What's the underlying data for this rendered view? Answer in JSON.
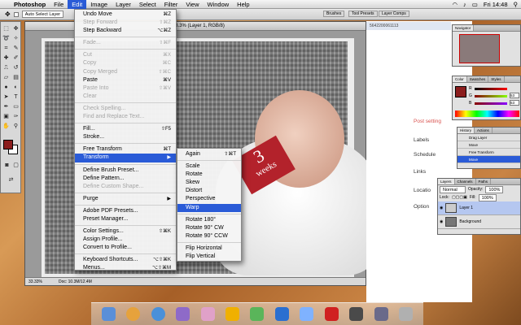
{
  "menubar": {
    "app_name": "Photoshop",
    "items": [
      "File",
      "Edit",
      "Image",
      "Layer",
      "Select",
      "Filter",
      "View",
      "Window",
      "Help"
    ],
    "active_item": "Edit",
    "clock": "Fri 14:48"
  },
  "options_bar": {
    "auto_select_label": "Auto Select Layer"
  },
  "document": {
    "title": "@ 33.3% (Layer 1, RGB/8)",
    "zoom": "33.33%",
    "doc_size": "Doc: 10.3M/12.4M",
    "photo_text_number": "3",
    "photo_text_word": "weeks"
  },
  "edit_menu": [
    {
      "label": "Undo Move",
      "shortcut": "⌘Z",
      "disabled": false
    },
    {
      "label": "Step Forward",
      "shortcut": "⇧⌘Z",
      "disabled": true
    },
    {
      "label": "Step Backward",
      "shortcut": "⌥⌘Z",
      "disabled": false
    },
    {
      "sep": true
    },
    {
      "label": "Fade...",
      "shortcut": "⇧⌘F",
      "disabled": true
    },
    {
      "sep": true
    },
    {
      "label": "Cut",
      "shortcut": "⌘X",
      "disabled": true
    },
    {
      "label": "Copy",
      "shortcut": "⌘C",
      "disabled": true
    },
    {
      "label": "Copy Merged",
      "shortcut": "⇧⌘C",
      "disabled": true
    },
    {
      "label": "Paste",
      "shortcut": "⌘V",
      "disabled": false
    },
    {
      "label": "Paste Into",
      "shortcut": "⇧⌘V",
      "disabled": true
    },
    {
      "label": "Clear",
      "shortcut": "",
      "disabled": true
    },
    {
      "sep": true
    },
    {
      "label": "Check Spelling...",
      "shortcut": "",
      "disabled": true
    },
    {
      "label": "Find and Replace Text...",
      "shortcut": "",
      "disabled": true
    },
    {
      "sep": true
    },
    {
      "label": "Fill...",
      "shortcut": "⇧F5",
      "disabled": false
    },
    {
      "label": "Stroke...",
      "shortcut": "",
      "disabled": false
    },
    {
      "sep": true
    },
    {
      "label": "Free Transform",
      "shortcut": "⌘T",
      "disabled": false
    },
    {
      "label": "Transform",
      "shortcut": "▶",
      "disabled": false,
      "highlight": true
    },
    {
      "sep": true
    },
    {
      "label": "Define Brush Preset...",
      "shortcut": "",
      "disabled": false
    },
    {
      "label": "Define Pattern...",
      "shortcut": "",
      "disabled": false
    },
    {
      "label": "Define Custom Shape...",
      "shortcut": "",
      "disabled": true
    },
    {
      "sep": true
    },
    {
      "label": "Purge",
      "shortcut": "▶",
      "disabled": false
    },
    {
      "sep": true
    },
    {
      "label": "Adobe PDF Presets...",
      "shortcut": "",
      "disabled": false
    },
    {
      "label": "Preset Manager...",
      "shortcut": "",
      "disabled": false
    },
    {
      "sep": true
    },
    {
      "label": "Color Settings...",
      "shortcut": "⇧⌘K",
      "disabled": false
    },
    {
      "label": "Assign Profile...",
      "shortcut": "",
      "disabled": false
    },
    {
      "label": "Convert to Profile...",
      "shortcut": "",
      "disabled": false
    },
    {
      "sep": true
    },
    {
      "label": "Keyboard Shortcuts...",
      "shortcut": "⌥⇧⌘K",
      "disabled": false
    },
    {
      "label": "Menus...",
      "shortcut": "⌥⇧⌘M",
      "disabled": false
    }
  ],
  "transform_menu": [
    {
      "label": "Again",
      "shortcut": "⇧⌘T"
    },
    {
      "sep": true
    },
    {
      "label": "Scale"
    },
    {
      "label": "Rotate"
    },
    {
      "label": "Skew"
    },
    {
      "label": "Distort"
    },
    {
      "label": "Perspective"
    },
    {
      "label": "Warp",
      "highlight": true
    },
    {
      "sep": true
    },
    {
      "label": "Rotate 180°"
    },
    {
      "label": "Rotate 90° CW"
    },
    {
      "label": "Rotate 90° CCW"
    },
    {
      "sep": true
    },
    {
      "label": "Flip Horizontal"
    },
    {
      "label": "Flip Vertical"
    }
  ],
  "web_page": {
    "post_settings": "Post setting",
    "rows": [
      "Labels",
      "Schedule",
      "Links",
      "Locatio",
      "Option"
    ]
  },
  "panels": {
    "navigator_tab": "Navigator",
    "color_tabs": [
      "Color",
      "Swatches",
      "Styles"
    ],
    "color_channels": [
      "R",
      "G",
      "B"
    ],
    "color_values": [
      "",
      "53",
      "53"
    ],
    "history_tabs": [
      "History",
      "Actions"
    ],
    "history_items": [
      "Drag Layer",
      "Move",
      "Free Transform",
      "Move"
    ],
    "layers_tabs": [
      "Layers",
      "Channels",
      "Paths"
    ],
    "blend_mode": "Normal",
    "opacity_label": "Opacity:",
    "opacity_value": "100%",
    "lock_label": "Lock:",
    "fill_label": "Fill:",
    "fill_value": "100%",
    "layers": [
      "Layer 1",
      "Background"
    ]
  },
  "tabs_top": [
    "Brushes",
    "Tool Presets",
    "Layer Comps"
  ],
  "url_fragment": "5642200061113",
  "colors": {
    "menu_highlight": "#2a5bd7",
    "foreground_swatch": "#8b1d1d",
    "sign_red": "#b3222b"
  }
}
